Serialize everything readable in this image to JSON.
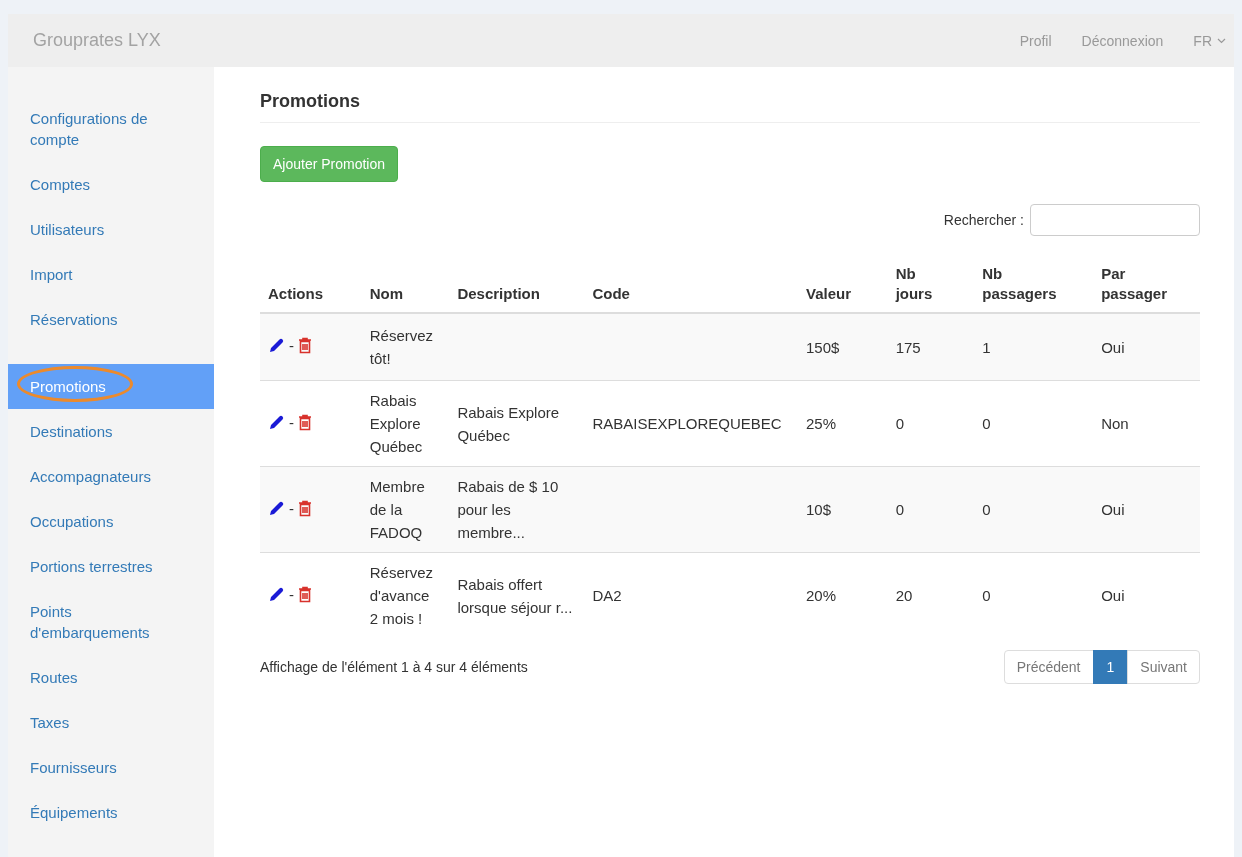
{
  "navbar": {
    "brand": "Grouprates LYX",
    "links": [
      "Profil",
      "Déconnexion"
    ],
    "language": "FR"
  },
  "sidebar": {
    "groups": [
      [
        {
          "label": "Configurations de compte",
          "selected": false,
          "circled": false
        },
        {
          "label": "Comptes",
          "selected": false,
          "circled": false
        },
        {
          "label": "Utilisateurs",
          "selected": false,
          "circled": false
        },
        {
          "label": "Import",
          "selected": false,
          "circled": false
        },
        {
          "label": "Réservations",
          "selected": false,
          "circled": false
        }
      ],
      [
        {
          "label": "Promotions",
          "selected": true,
          "circled": true
        },
        {
          "label": "Destinations",
          "selected": false,
          "circled": false
        },
        {
          "label": "Accompagnateurs",
          "selected": false,
          "circled": false
        },
        {
          "label": "Occupations",
          "selected": false,
          "circled": false
        },
        {
          "label": "Portions terrestres",
          "selected": false,
          "circled": false
        },
        {
          "label": "Points d'embarquements",
          "selected": false,
          "circled": false
        },
        {
          "label": "Routes",
          "selected": false,
          "circled": false
        },
        {
          "label": "Taxes",
          "selected": false,
          "circled": false
        },
        {
          "label": "Fournisseurs",
          "selected": false,
          "circled": false
        },
        {
          "label": "Équipements",
          "selected": false,
          "circled": false
        }
      ]
    ]
  },
  "page": {
    "title": "Promotions",
    "add_button": "Ajouter Promotion",
    "search_label": "Rechercher :"
  },
  "table": {
    "columns": [
      "Actions",
      "Nom",
      "Description",
      "Code",
      "Valeur",
      "Nb jours",
      "Nb passagers",
      "Par passager"
    ],
    "action_separator": "-",
    "rows": [
      {
        "nom": "Réservez tôt!",
        "description": "",
        "code": "",
        "valeur": "150$",
        "nb_jours": "175",
        "nb_passagers": "1",
        "par_passager": "Oui"
      },
      {
        "nom": "Rabais Explore Québec",
        "description": "Rabais Explore Québec",
        "code": "RABAISEXPLOREQUEBEC",
        "valeur": "25%",
        "nb_jours": "0",
        "nb_passagers": "0",
        "par_passager": "Non"
      },
      {
        "nom": "Membre de la FADOQ",
        "description": "Rabais de $ 10 pour les membre...",
        "code": "",
        "valeur": "10$",
        "nb_jours": "0",
        "nb_passagers": "0",
        "par_passager": "Oui"
      },
      {
        "nom": "Réservez d'avance 2 mois !",
        "description": "Rabais offert lorsque séjour r...",
        "code": "DA2",
        "valeur": "20%",
        "nb_jours": "20",
        "nb_passagers": "0",
        "par_passager": "Oui"
      }
    ]
  },
  "footer": {
    "info": "Affichage de l'élément 1 à 4 sur 4 éléments",
    "pagination": [
      {
        "label": "Précédent",
        "kind": "nav",
        "selected": false
      },
      {
        "label": "1",
        "kind": "page",
        "selected": true
      },
      {
        "label": "Suivant",
        "kind": "nav",
        "selected": false
      }
    ]
  }
}
